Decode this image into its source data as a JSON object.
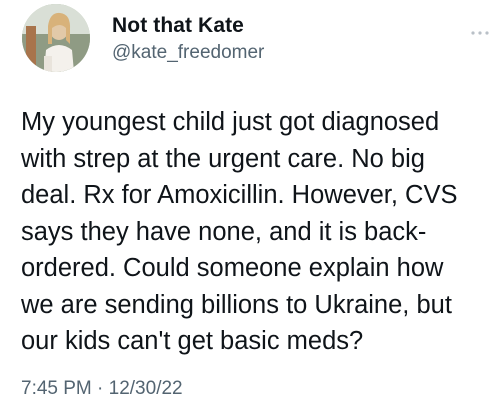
{
  "author": {
    "display_name": "Not that Kate",
    "handle": "@kate_freedomer",
    "avatar_icon": "profile-photo"
  },
  "more_icon": "ellipsis-icon",
  "tweet": {
    "lines": [
      "My youngest child just got diagnosed",
      "with strep at the urgent care. No big",
      "deal. Rx for Amoxicillin. However, CVS",
      "says they have none, and it is back-",
      "ordered. Could someone explain how",
      "we are sending billions to Ukraine, but",
      "our kids can't get basic meds?"
    ],
    "timestamp": "7:45 PM · 12/30/22"
  },
  "colors": {
    "text": "#0f1419",
    "secondary": "#536471",
    "background": "#ffffff"
  }
}
